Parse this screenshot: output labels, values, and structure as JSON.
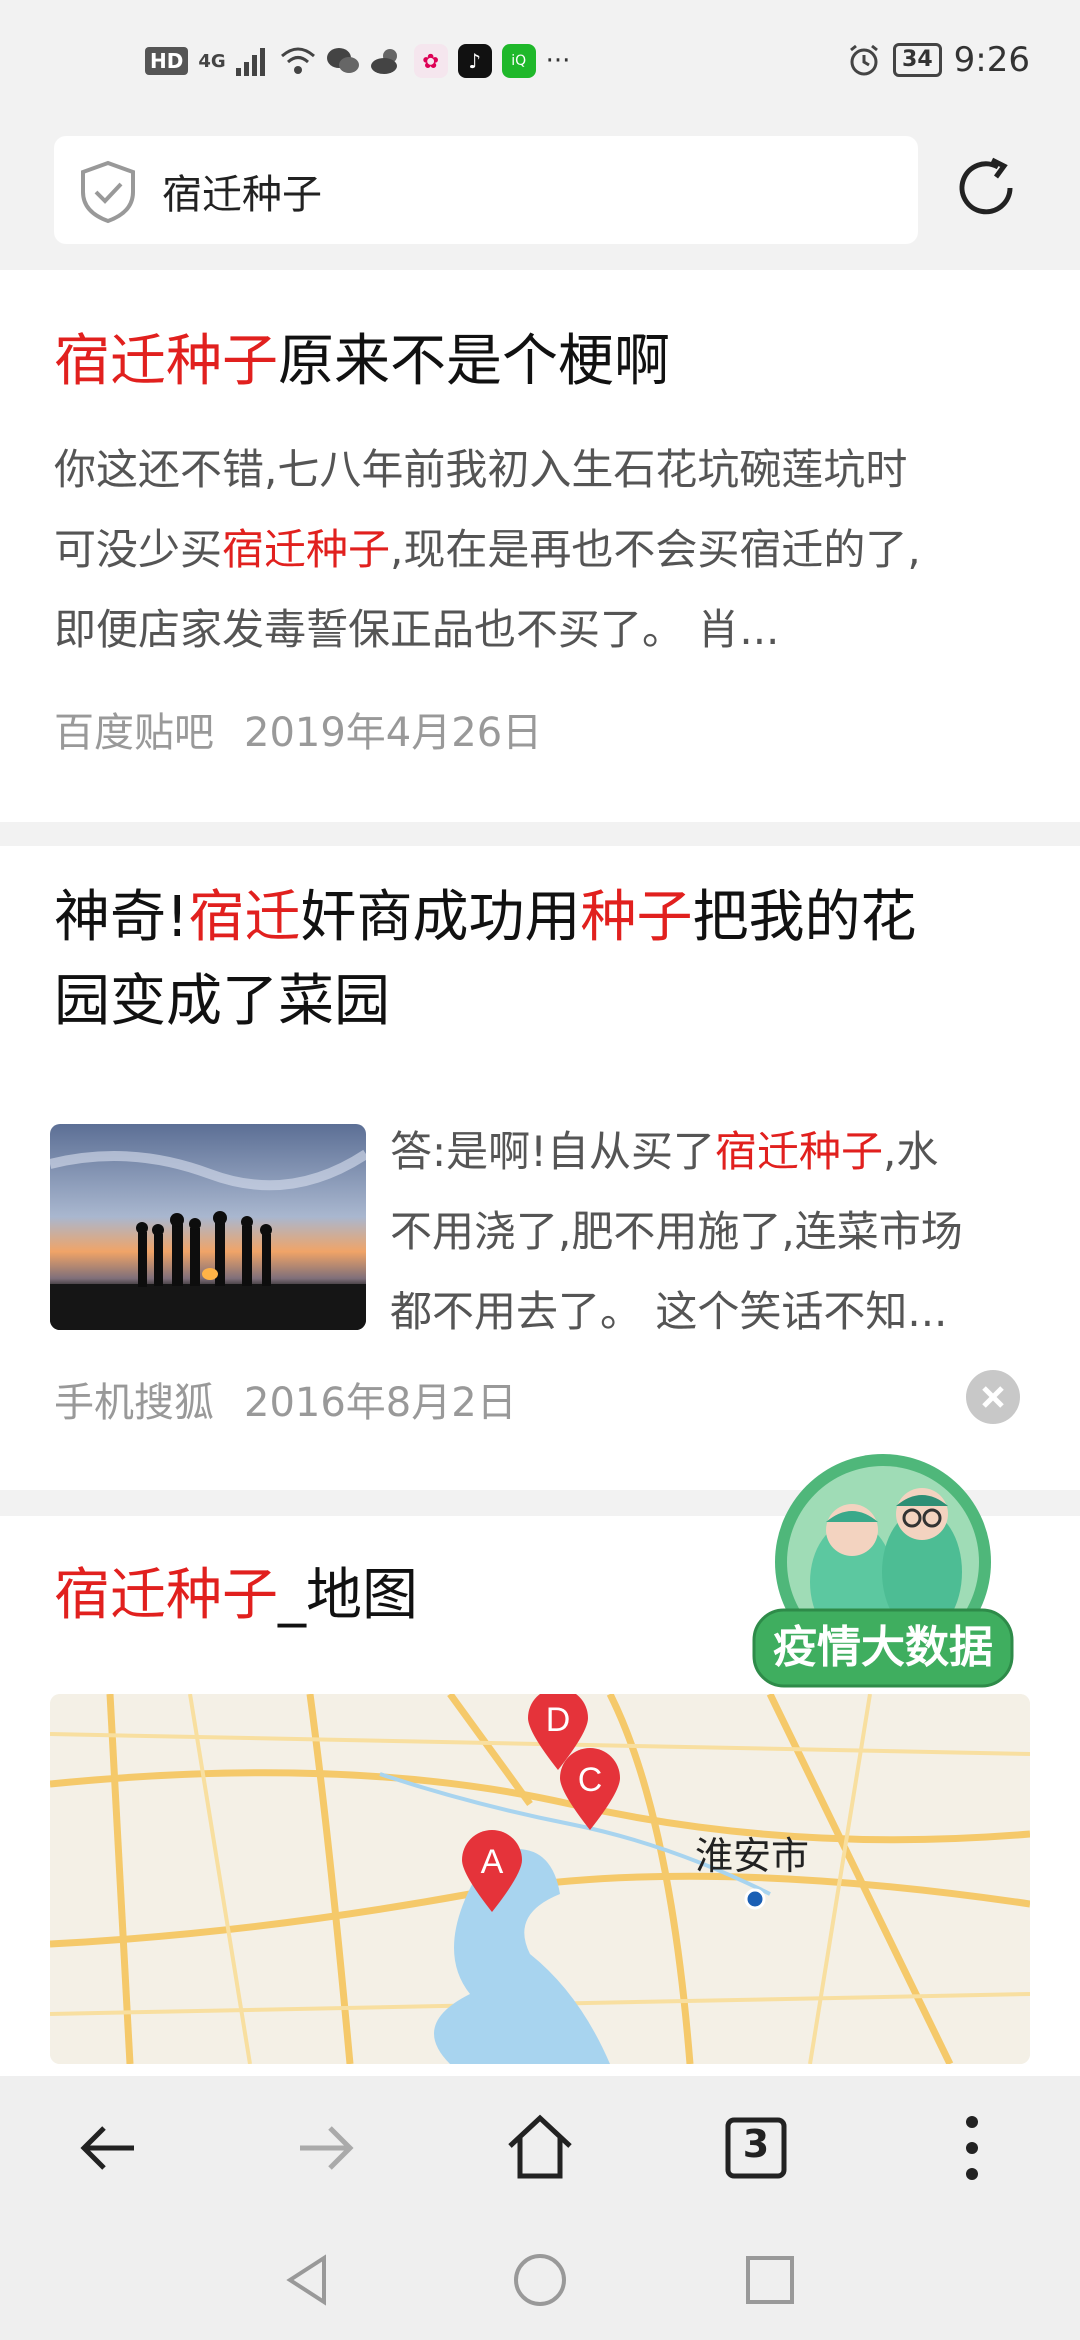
{
  "status_bar": {
    "hd": "HD",
    "network": "4G",
    "more": "···",
    "battery": "34",
    "time": "9:26"
  },
  "search": {
    "query": "宿迁种子"
  },
  "results": [
    {
      "title_red": "宿迁种子",
      "title_rest": "原来不是个梗啊",
      "snippet_1": "你这还不错,七八年前我初入生石花坑碗莲坑时",
      "snippet_2a": "可没少买",
      "snippet_2b": "宿迁种子",
      "snippet_2c": ",现在是再也不会买宿迁的了,",
      "snippet_3": "即便店家发毒誓保正品也不买了。 肖...",
      "source": "百度贴吧",
      "date": "2019年4月26日"
    },
    {
      "title_a": "神奇!",
      "title_b": "宿迁",
      "title_c": "奸商成功用",
      "title_d": "种子",
      "title_e": "把我的花",
      "title_f": "园变成了菜园",
      "snippet_1a": "答:是啊!自从买了",
      "snippet_1b": "宿迁种子",
      "snippet_1c": ",水",
      "snippet_2": "不用浇了,肥不用施了,连菜市场",
      "snippet_3": "都不用去了。 这个笑话不知...",
      "source": "手机搜狐",
      "date": "2016年8月2日"
    },
    {
      "title_red": "宿迁种子",
      "title_rest": "_地图",
      "map_city": "淮安市",
      "markers": [
        "A",
        "C",
        "D"
      ]
    }
  ],
  "badge": {
    "label": "疫情大数据"
  },
  "toolbar": {
    "tabs_count": "3"
  },
  "icons": [
    "shield-icon",
    "refresh-icon",
    "back-icon",
    "forward-icon",
    "home-icon",
    "tabs-icon",
    "menu-icon",
    "close-icon"
  ],
  "colors": {
    "highlight": "#e1201e",
    "badge_green": "#3fae5f"
  }
}
